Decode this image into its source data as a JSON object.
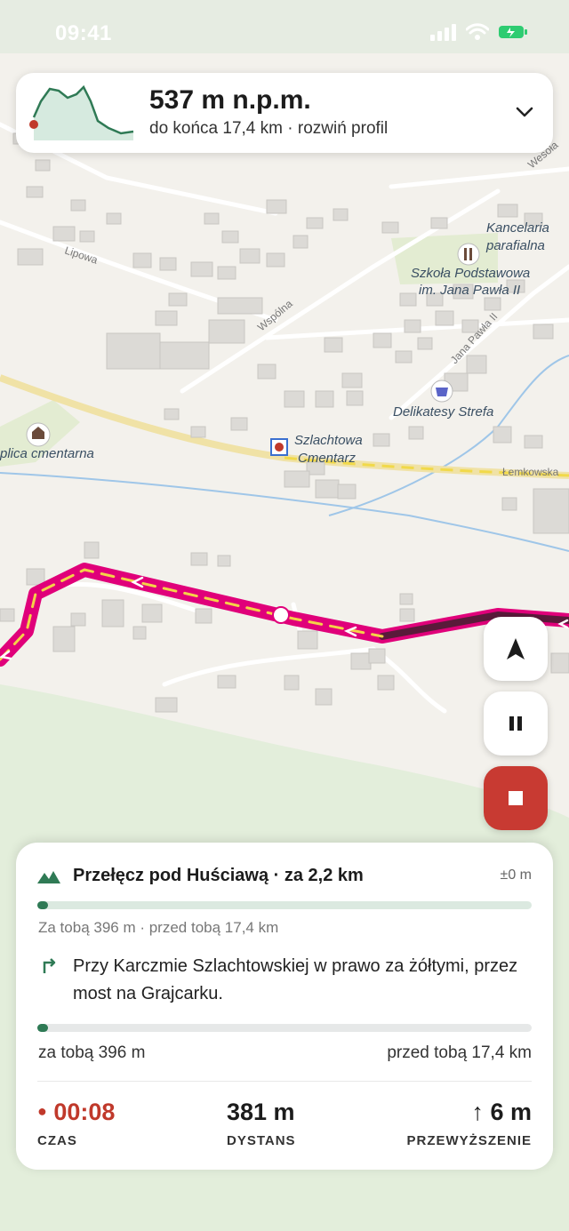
{
  "status_bar": {
    "time": "09:41"
  },
  "elevation": {
    "value": "537 m n.p.m.",
    "subtitle": "do końca 17,4 km · rozwiń profil"
  },
  "map": {
    "labels": {
      "kancelaria_1": "Kancelaria",
      "kancelaria_2": "parafialna",
      "szkola_1": "Szkoła Podstawowa",
      "szkola_2": "im. Jana Pawła II",
      "delikatesy": "Delikatesy Strefa",
      "kaplica": "plica cmentarna",
      "szlachtowa_1": "Szlachtowa",
      "szlachtowa_2": "Cmentarz",
      "lipowa": "Lipowa",
      "wspolna": "Wspólna",
      "jana_pawla": "Jana Pawła II",
      "lemkowska": "Łemkowska",
      "wesola": "Wesoła"
    }
  },
  "colors": {
    "route": "#e0007a",
    "accent_green": "#2f7a55",
    "stop_red": "#c83a32"
  },
  "waypoint": {
    "title": "Przełęcz pod Huściawą · za 2,2 km",
    "elevation_delta": "±0 m",
    "progress_fraction": 0.022,
    "distance_line": "Za tobą 396 m · przed tobą 17,4 km"
  },
  "instruction": {
    "text": "Przy Karczmie Szlachtowskiej w prawo za żółtymi, przez most na Grajcarku.",
    "progress_fraction": 0.022,
    "behind": "za tobą 396 m",
    "ahead": "przed tobą 17,4 km"
  },
  "stats": {
    "time": {
      "value": "00:08",
      "label": "CZAS"
    },
    "distance": {
      "value": "381 m",
      "label": "DYSTANS"
    },
    "elevation_gain": {
      "value": "↑ 6 m",
      "label": "PRZEWYŻSZENIE"
    }
  }
}
